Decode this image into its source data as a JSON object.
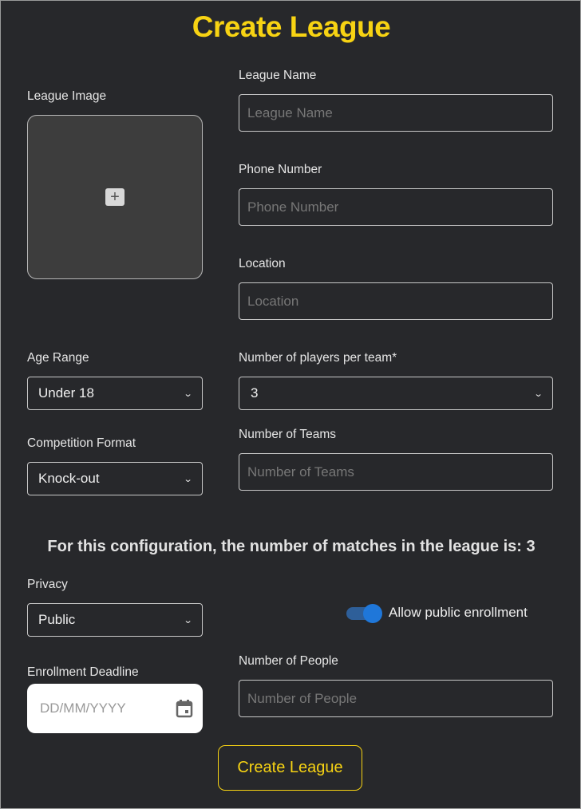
{
  "page_title": "Create League",
  "fields": {
    "league_image": {
      "label": "League Image"
    },
    "league_name": {
      "label": "League Name",
      "placeholder": "League Name",
      "value": ""
    },
    "phone_number": {
      "label": "Phone Number",
      "placeholder": "Phone Number",
      "value": ""
    },
    "location": {
      "label": "Location",
      "placeholder": "Location",
      "value": ""
    },
    "age_range": {
      "label": "Age Range",
      "selected": "Under 18"
    },
    "players_per_team": {
      "label": "Number of players per team*",
      "selected": "3"
    },
    "competition_format": {
      "label": "Competition Format",
      "selected": "Knock-out"
    },
    "number_of_teams": {
      "label": "Number of Teams",
      "placeholder": "Number of Teams",
      "value": ""
    },
    "privacy": {
      "label": "Privacy",
      "selected": "Public"
    },
    "allow_public_enrollment": {
      "label": "Allow public enrollment",
      "checked": true
    },
    "enrollment_deadline": {
      "label": "Enrollment Deadline",
      "placeholder": "DD/MM/YYYY"
    },
    "number_of_people": {
      "label": "Number of People",
      "placeholder": "Number of People",
      "value": ""
    }
  },
  "info_text": "For this configuration, the number of matches in the league is: 3",
  "submit_label": "Create League",
  "colors": {
    "accent": "#f7d313",
    "background": "#27282b",
    "toggle": "#1f77d9"
  }
}
